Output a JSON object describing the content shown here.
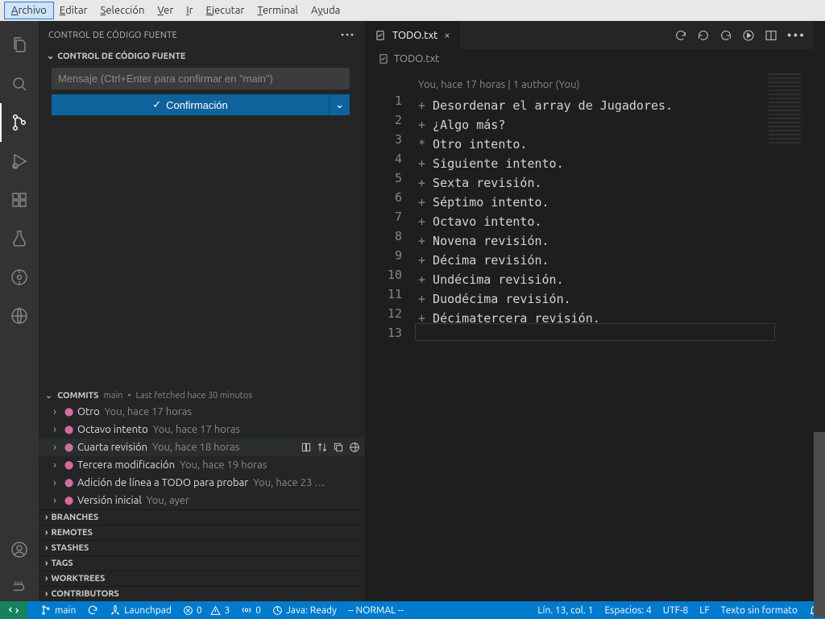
{
  "menubar": [
    "Archivo",
    "Editar",
    "Selección",
    "Ver",
    "Ir",
    "Ejecutar",
    "Terminal",
    "Ayuda"
  ],
  "menubar_underline_indices": [
    0,
    0,
    0,
    0,
    0,
    0,
    0,
    1
  ],
  "sidebar": {
    "title": "CONTROL DE CÓDIGO FUENTE",
    "repo_header": "CONTROL DE CÓDIGO FUENTE",
    "msg_placeholder": "Mensaje (Ctrl+Enter para confirmar en \"main\")",
    "commit_button": "Confirmación",
    "commits_header": "COMMITS",
    "commits_branch": "main",
    "commits_sep": "•",
    "commits_fetched": "Last fetched hace 30 minutos",
    "commits": [
      {
        "msg": "Otro",
        "meta": "You, hace 17 horas"
      },
      {
        "msg": "Octavo intento",
        "meta": "You, hace 17 horas"
      },
      {
        "msg": "Cuarta revisión",
        "meta": "You, hace 18 horas",
        "hover": true
      },
      {
        "msg": "Tercera modificación",
        "meta": "You, hace 19 horas"
      },
      {
        "msg": "Adición de línea a TODO para probar",
        "meta": "You, hace 23 …"
      },
      {
        "msg": "Versión inicial",
        "meta": "You, ayer"
      }
    ],
    "sections": [
      "BRANCHES",
      "REMOTES",
      "STASHES",
      "TAGS",
      "WORKTREES",
      "CONTRIBUTORS"
    ]
  },
  "editor": {
    "tab_name": "TODO.txt",
    "breadcrumb": "TODO.txt",
    "code_lens": "You, hace 17 horas | 1 author (You)",
    "lines": [
      {
        "n": 1,
        "sym": "+",
        "text": "Desordenar el array de Jugadores."
      },
      {
        "n": 2,
        "sym": "+",
        "text": "¿Algo más?"
      },
      {
        "n": 3,
        "sym": "*",
        "text": "Otro intento."
      },
      {
        "n": 4,
        "sym": "+",
        "text": "Siguiente intento."
      },
      {
        "n": 5,
        "sym": "+",
        "text": "Sexta revisión."
      },
      {
        "n": 6,
        "sym": "+",
        "text": "Séptimo intento."
      },
      {
        "n": 7,
        "sym": "+",
        "text": "Octavo intento."
      },
      {
        "n": 8,
        "sym": "+",
        "text": "Novena revisión."
      },
      {
        "n": 9,
        "sym": "+",
        "text": "Décima revisión."
      },
      {
        "n": 10,
        "sym": "+",
        "text": "Undécima revisión."
      },
      {
        "n": 11,
        "sym": "+",
        "text": "Duodécima revisión."
      },
      {
        "n": 12,
        "sym": "+",
        "text": "Décimatercera revisión."
      },
      {
        "n": 13,
        "sym": "",
        "text": ""
      }
    ]
  },
  "statusbar": {
    "branch": "main",
    "launchpad": "Launchpad",
    "errors": "0",
    "warnings": "3",
    "ports": "0",
    "java": "Java: Ready",
    "vim_mode": "-- NORMAL --",
    "position": "Lín. 13, col. 1",
    "spaces": "Espacios: 4",
    "encoding": "UTF-8",
    "eol": "LF",
    "lang": "Texto sin formato"
  }
}
